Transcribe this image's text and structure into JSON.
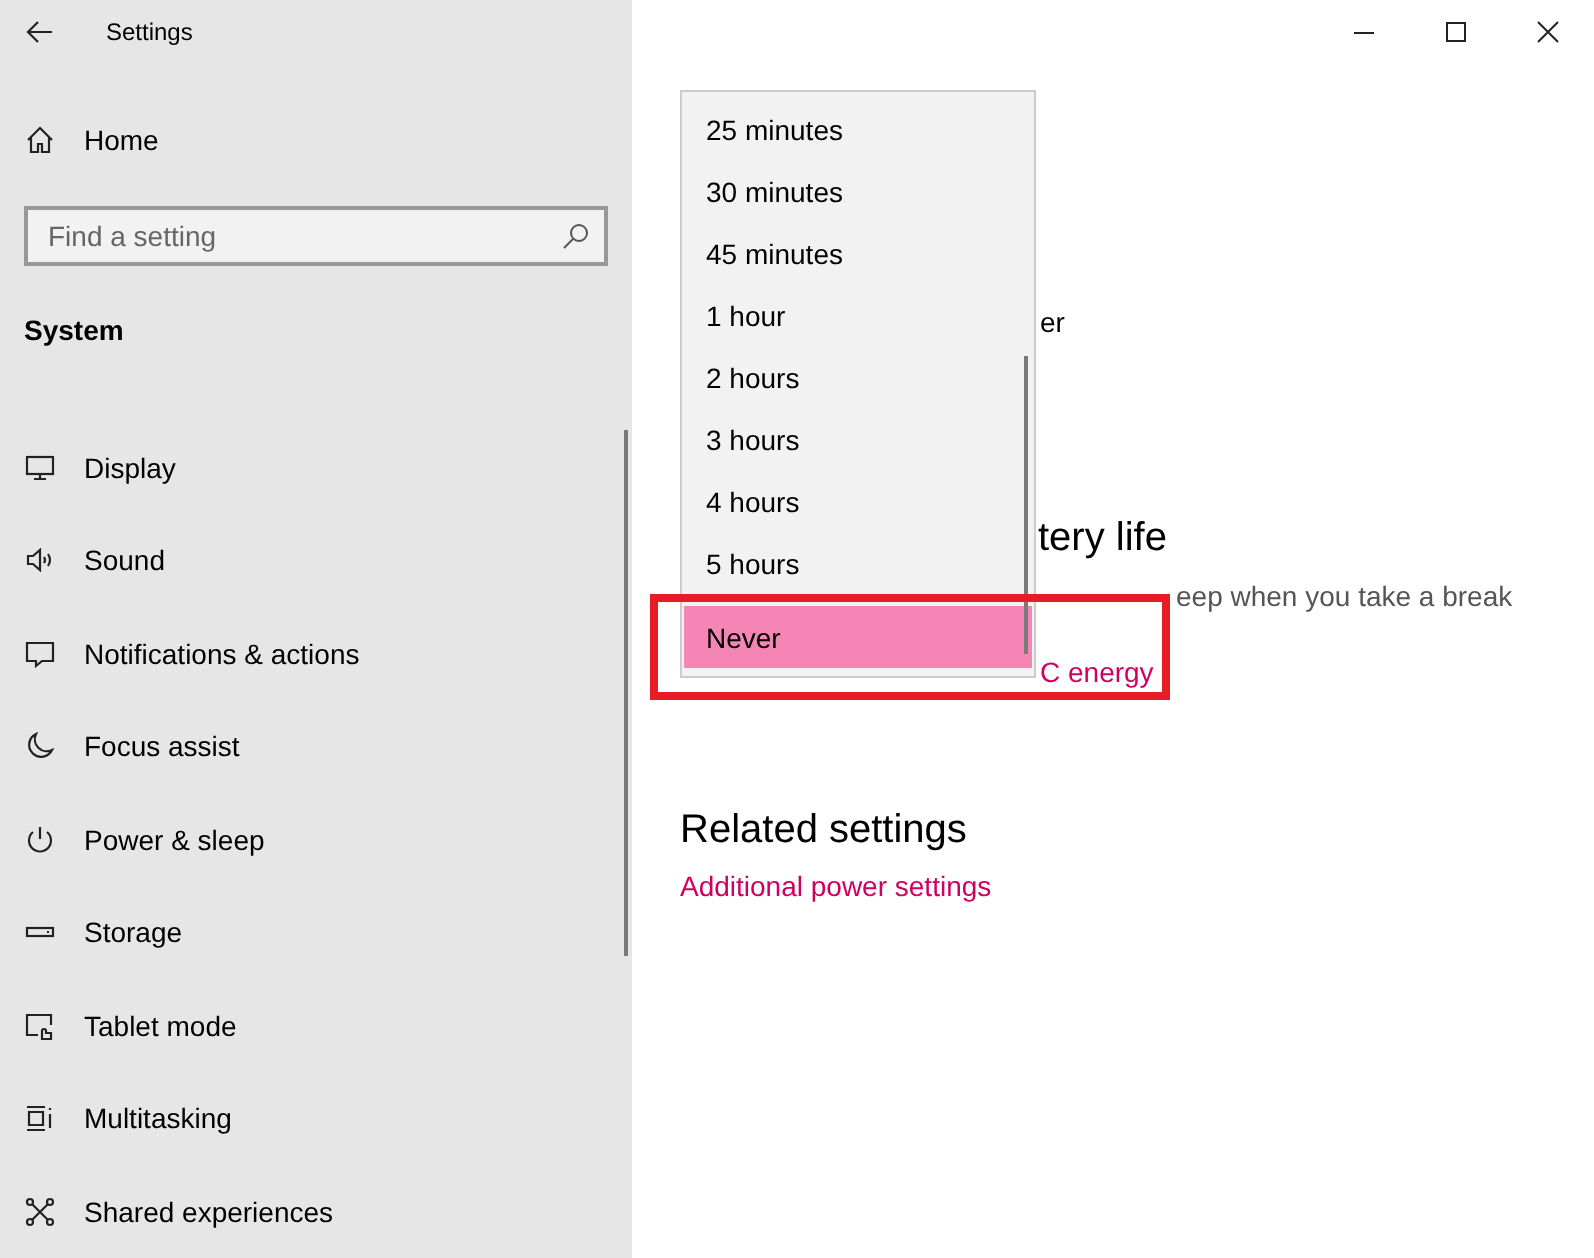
{
  "window": {
    "title": "Settings"
  },
  "sidebar": {
    "home": "Home",
    "search": {
      "placeholder": "Find a setting"
    },
    "section": "System",
    "items": [
      {
        "label": "Display"
      },
      {
        "label": "Sound"
      },
      {
        "label": "Notifications & actions"
      },
      {
        "label": "Focus assist"
      },
      {
        "label": "Power & sleep"
      },
      {
        "label": "Storage"
      },
      {
        "label": "Tablet mode"
      },
      {
        "label": "Multitasking"
      },
      {
        "label": "Shared experiences"
      }
    ]
  },
  "content": {
    "partial_label": "er",
    "partial_heading": "tery life",
    "partial_description": "eep when you take a break",
    "partial_link": "C energy",
    "related": {
      "heading": "Related settings",
      "link": "Additional power settings"
    }
  },
  "dropdown": {
    "options": [
      {
        "label": "25 minutes",
        "selected": false
      },
      {
        "label": "30 minutes",
        "selected": false
      },
      {
        "label": "45 minutes",
        "selected": false
      },
      {
        "label": "1 hour",
        "selected": false
      },
      {
        "label": "2 hours",
        "selected": false
      },
      {
        "label": "3 hours",
        "selected": false
      },
      {
        "label": "4 hours",
        "selected": false
      },
      {
        "label": "5 hours",
        "selected": false
      },
      {
        "label": "Never",
        "selected": true
      }
    ]
  }
}
